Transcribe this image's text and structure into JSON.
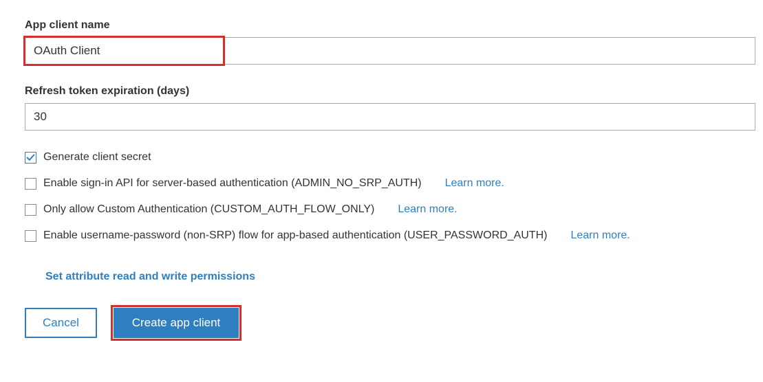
{
  "appClientName": {
    "label": "App client name",
    "value": "OAuth Client"
  },
  "refreshTokenExpiration": {
    "label": "Refresh token expiration (days)",
    "value": "30"
  },
  "options": {
    "generateSecret": {
      "label": "Generate client secret",
      "checked": true
    },
    "adminNoSrp": {
      "label": "Enable sign-in API for server-based authentication (ADMIN_NO_SRP_AUTH)",
      "checked": false,
      "learnMore": "Learn more."
    },
    "customAuthOnly": {
      "label": "Only allow Custom Authentication (CUSTOM_AUTH_FLOW_ONLY)",
      "checked": false,
      "learnMore": "Learn more."
    },
    "userPasswordAuth": {
      "label": "Enable username-password (non-SRP) flow for app-based authentication (USER_PASSWORD_AUTH)",
      "checked": false,
      "learnMore": "Learn more."
    }
  },
  "links": {
    "setPermissions": "Set attribute read and write permissions"
  },
  "buttons": {
    "cancel": "Cancel",
    "create": "Create app client"
  }
}
